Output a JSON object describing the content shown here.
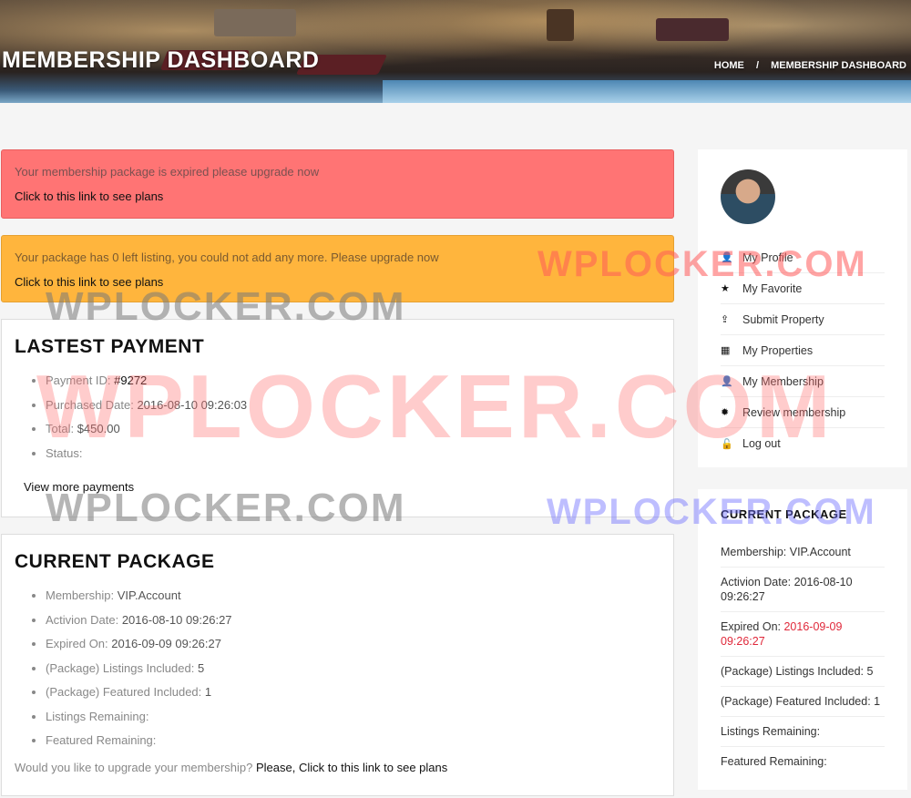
{
  "header": {
    "title": "MEMBERSHIP DASHBOARD",
    "breadcrumb_home": "HOME",
    "breadcrumb_sep": "/",
    "breadcrumb_current": "MEMBERSHIP DASHBOARD"
  },
  "alerts": {
    "expired_msg": "Your membership package is expired please upgrade now",
    "expired_link": "Click to this link to see plans",
    "listing_msg": "Your package has 0 left listing, you could not add any more. Please upgrade now",
    "listing_link": "Click to this link to see plans"
  },
  "payment": {
    "title": "LASTEST PAYMENT",
    "items": [
      {
        "label": "Payment ID: ",
        "value": "#9272"
      },
      {
        "label": "Purchased Date: ",
        "value": "2016-08-10 09:26:03"
      },
      {
        "label": "Total: ",
        "value": "$450.00"
      },
      {
        "label": "Status:",
        "value": ""
      }
    ],
    "view_more": "View more payments"
  },
  "package": {
    "title": "CURRENT PACKAGE",
    "items": [
      {
        "label": "Membership: ",
        "value": "VIP.Account"
      },
      {
        "label": "Activion Date: ",
        "value": "2016-08-10 09:26:27"
      },
      {
        "label": "Expired On: ",
        "value": "2016-09-09 09:26:27"
      },
      {
        "label": "(Package) Listings Included: ",
        "value": "5"
      },
      {
        "label": "(Package) Featured Included: ",
        "value": "1"
      },
      {
        "label": "Listings Remaining:",
        "value": ""
      },
      {
        "label": "Featured Remaining:",
        "value": ""
      }
    ],
    "upgrade_question": "Would you like to upgrade your membership? ",
    "upgrade_link": "Please, Click to this link to see plans"
  },
  "sidebar": {
    "menu": [
      {
        "label": "My Profile",
        "icon": "user-icon",
        "glyph": "👤"
      },
      {
        "label": "My Favorite",
        "icon": "star-icon",
        "glyph": "★"
      },
      {
        "label": "Submit Property",
        "icon": "upload-icon",
        "glyph": "⇪"
      },
      {
        "label": "My Properties",
        "icon": "building-icon",
        "glyph": "▦"
      },
      {
        "label": "My Membership",
        "icon": "user-icon",
        "glyph": "👤"
      },
      {
        "label": "Review membership",
        "icon": "gear-icon",
        "glyph": "✹"
      },
      {
        "label": "Log out",
        "icon": "unlock-icon",
        "glyph": "🔓"
      }
    ],
    "package_title": "CURRENT PACKAGE",
    "package_items": [
      {
        "label": "Membership: ",
        "value": "VIP.Account"
      },
      {
        "label": "Activion Date: ",
        "value": "2016-08-10 09:26:27"
      },
      {
        "label": "Expired On: ",
        "value": "2016-09-09 09:26:27"
      },
      {
        "label": "(Package) Listings Included: ",
        "value": "5"
      },
      {
        "label": "(Package) Featured Included: ",
        "value": "1"
      },
      {
        "label": "Listings Remaining:",
        "value": ""
      },
      {
        "label": "Featured Remaining:",
        "value": ""
      }
    ]
  },
  "watermarks": {
    "text": "WPLOCKER.COM"
  },
  "colors": {
    "danger": "#ff7474",
    "warning": "#ffb53d",
    "expired_red": "#e0283a"
  }
}
